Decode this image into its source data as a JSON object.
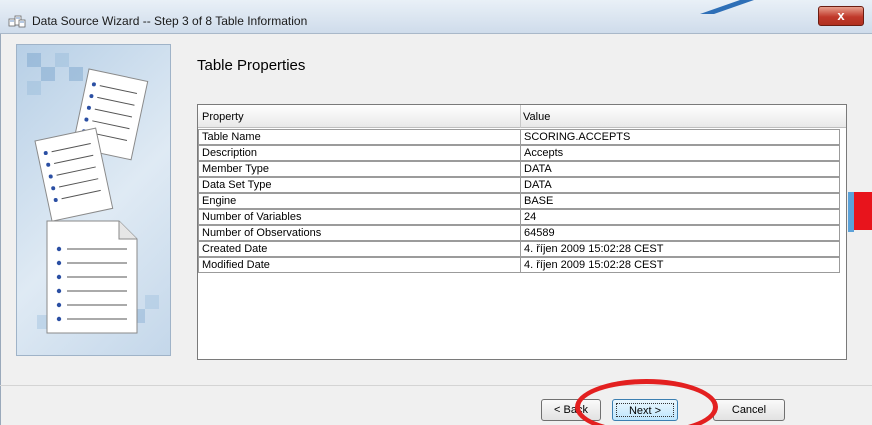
{
  "window": {
    "title": "Data Source Wizard  -- Step 3 of 8  Table Information",
    "close_label": "x"
  },
  "panel": {
    "heading": "Table Properties"
  },
  "table": {
    "columns": [
      "Property",
      "Value"
    ],
    "rows": [
      {
        "property": "Table Name",
        "value": "SCORING.ACCEPTS"
      },
      {
        "property": "Description",
        "value": "Accepts"
      },
      {
        "property": "Member Type",
        "value": "DATA"
      },
      {
        "property": "Data Set Type",
        "value": "DATA"
      },
      {
        "property": "Engine",
        "value": "BASE"
      },
      {
        "property": "Number of Variables",
        "value": "24"
      },
      {
        "property": "Number of Observations",
        "value": "64589"
      },
      {
        "property": "Created Date",
        "value": "4. říjen 2009 15:02:28 CEST"
      },
      {
        "property": "Modified Date",
        "value": "4. říjen 2009 15:02:28 CEST"
      }
    ]
  },
  "buttons": {
    "back": "< Back",
    "next": "Next >",
    "cancel": "Cancel"
  },
  "colors": {
    "annotation_red": "#e32020",
    "title_bar": "#d8e4f0"
  }
}
